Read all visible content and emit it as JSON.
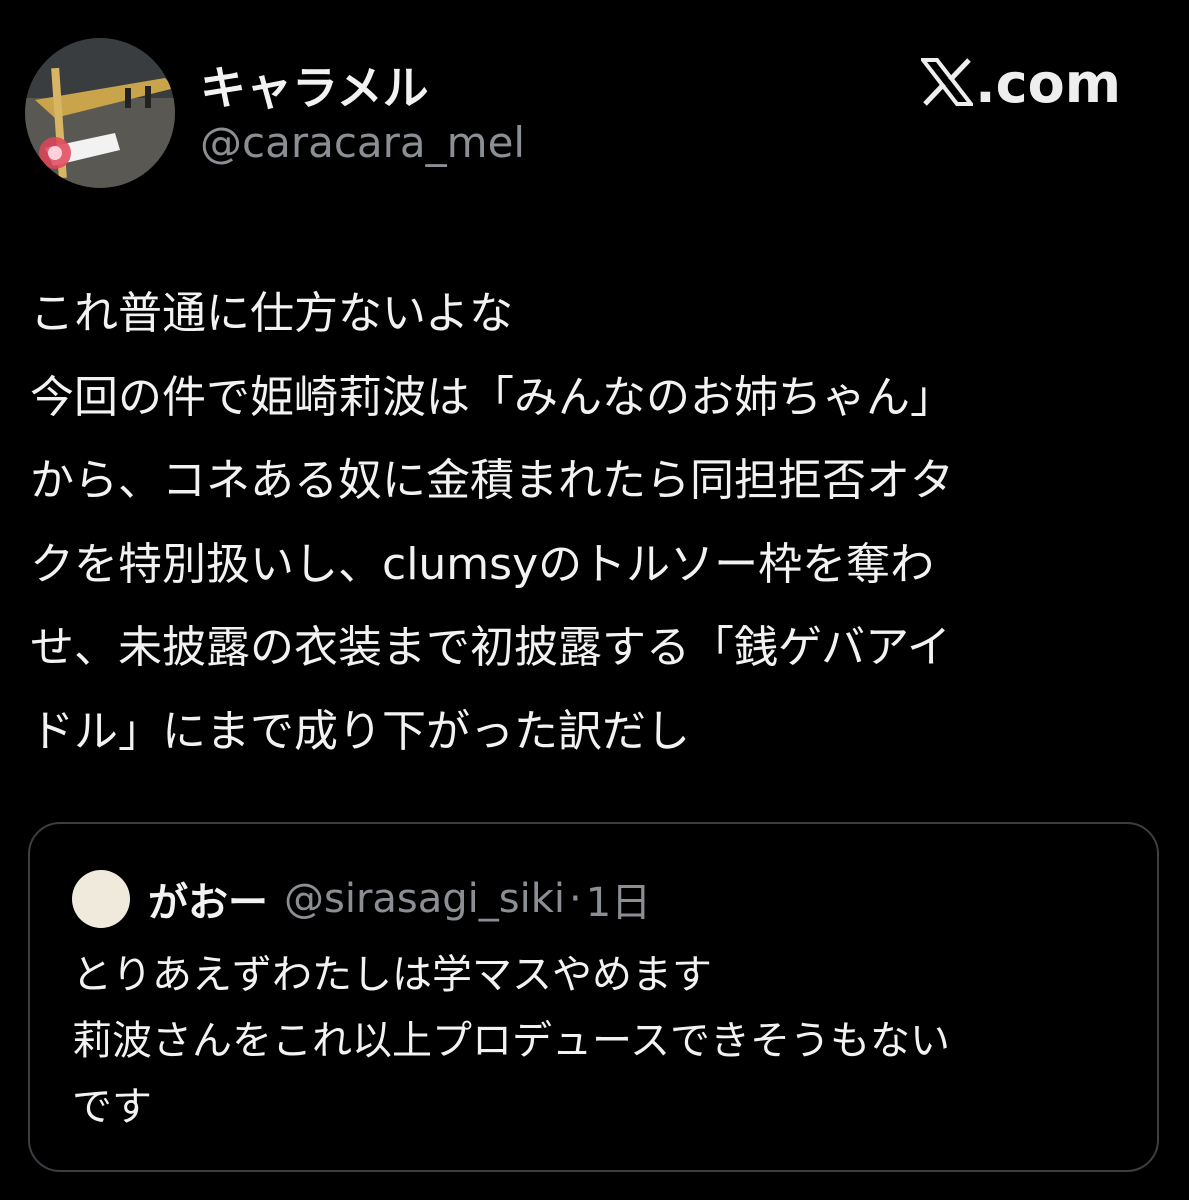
{
  "author": {
    "display_name": "キャラメル",
    "handle": "@caracara_mel",
    "avatar_icon": "profile-photo-icon"
  },
  "brand": {
    "site_text": ".com",
    "logo_icon": "x-logo-icon"
  },
  "tweet": {
    "lines": [
      "これ普通に仕方ないよな",
      "今回の件で姫崎莉波は「みんなのお姉ちゃん」",
      "から、コネある奴に金積まれたら同担拒否オタ",
      "クを特別扱いし、clumsyのトルソー枠を奪わ",
      "せ、未披露の衣装まで初披露する「銭ゲバアイ",
      "ドル」にまで成り下がった訳だし"
    ]
  },
  "quote": {
    "display_name": "がおー",
    "handle": "@sirasagi_siki",
    "separator": "·",
    "time": "1日",
    "avatar_icon": "avatar-icon",
    "lines": [
      "とりあえずわたしは学マスやめます",
      "莉波さんをこれ以上プロデュースできそうもない",
      "です"
    ]
  },
  "colors": {
    "background": "#000000",
    "primary_text": "#f2f2f2",
    "secondary_text": "#8b8f94",
    "card_border": "#3b3f44"
  }
}
